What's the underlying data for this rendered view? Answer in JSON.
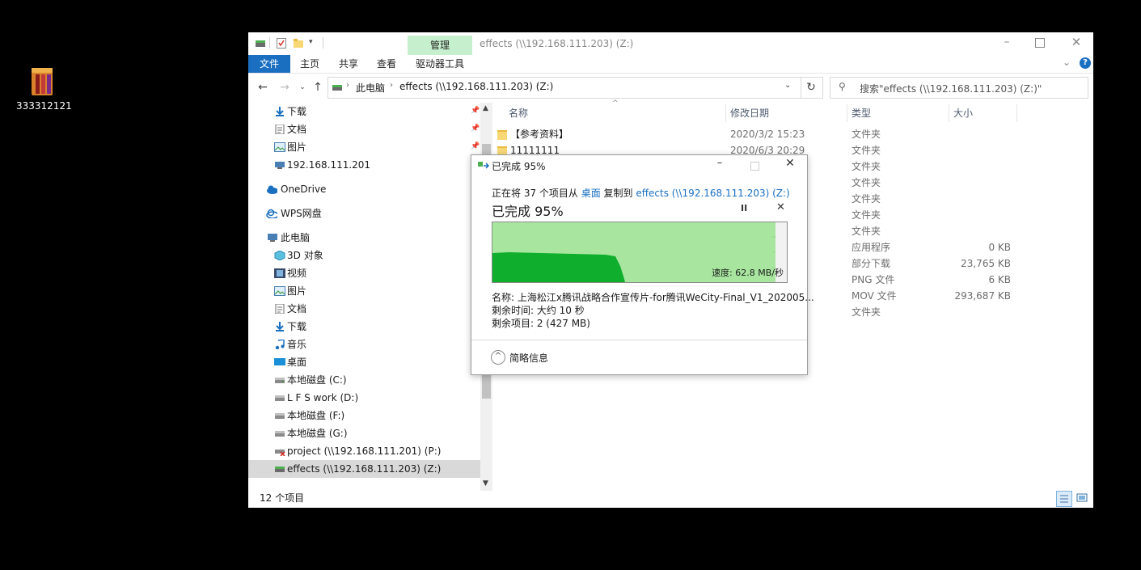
{
  "desktop": {
    "icon_label": "333312121"
  },
  "window": {
    "title": "effects (\\\\192.168.111.203) (Z:)",
    "manage_tab": "管理",
    "tabs": [
      "文件",
      "主页",
      "共享",
      "查看",
      "驱动器工具"
    ]
  },
  "address": {
    "crumbs": [
      "此电脑",
      "effects (\\\\192.168.111.203) (Z:)"
    ],
    "search_placeholder": "搜索\"effects (\\\\192.168.111.203) (Z:)\""
  },
  "nav": {
    "quick": [
      "下载",
      "文档",
      "图片",
      "192.168.111.201"
    ],
    "onedrive": "OneDrive",
    "wps": "WPS网盘",
    "thispc": "此电脑",
    "pc_items": [
      "3D 对象",
      "视频",
      "图片",
      "文档",
      "下载",
      "音乐",
      "桌面",
      "本地磁盘 (C:)",
      "L F S work (D:)",
      "本地磁盘 (F:)",
      "本地磁盘 (G:)",
      "project (\\\\192.168.111.201) (P:)",
      "effects (\\\\192.168.111.203) (Z:)"
    ]
  },
  "columns": {
    "name": "名称",
    "date": "修改日期",
    "type": "类型",
    "size": "大小"
  },
  "files": [
    {
      "name": "【参考资料】",
      "date": "2020/3/2 15:23",
      "type": "文件夹",
      "size": ""
    },
    {
      "name": "11111111",
      "date": "2020/6/3 20:29",
      "type": "文件夹",
      "size": ""
    },
    {
      "name": "",
      "date": "",
      "type": "文件夹",
      "size": ""
    },
    {
      "name": "",
      "date": "",
      "type": "文件夹",
      "size": ""
    },
    {
      "name": "",
      "date": "",
      "type": "文件夹",
      "size": ""
    },
    {
      "name": "",
      "date": "",
      "type": "文件夹",
      "size": ""
    },
    {
      "name": "",
      "date": "",
      "type": "文件夹",
      "size": ""
    },
    {
      "name": "",
      "date": "",
      "type": "应用程序",
      "size": "0 KB"
    },
    {
      "name": "",
      "date": "",
      "type": "部分下载",
      "size": "23,765 KB"
    },
    {
      "name": "",
      "date": "",
      "type": "PNG 文件",
      "size": "6 KB"
    },
    {
      "name": "",
      "date": "",
      "type": "MOV 文件",
      "size": "293,687 KB"
    },
    {
      "name": "",
      "date": "",
      "type": "文件夹",
      "size": ""
    }
  ],
  "status": {
    "count": "12 个项目"
  },
  "dialog": {
    "title": "已完成 95%",
    "line_prefix": "正在将 37 个项目从 ",
    "source": "桌面",
    "line_mid": " 复制到 ",
    "dest": "effects (\\\\192.168.111.203) (Z:)",
    "heading": "已完成 95%",
    "speed": "速度: 62.8 MB/秒",
    "progress": 0.95,
    "name_line": "名称: 上海松江x腾讯战略合作宣传片-for腾讯WeCity-Final_V1_202005...",
    "time_line": "剩余时间: 大约 10 秒",
    "items_line": "剩余项目: 2 (427 MB)",
    "less_details": "简略信息"
  },
  "colors": {
    "accent": "#1a6fc1",
    "manage": "#c6efce",
    "graph": "#a8e6a0",
    "graph_fill": "#0fae2c"
  }
}
